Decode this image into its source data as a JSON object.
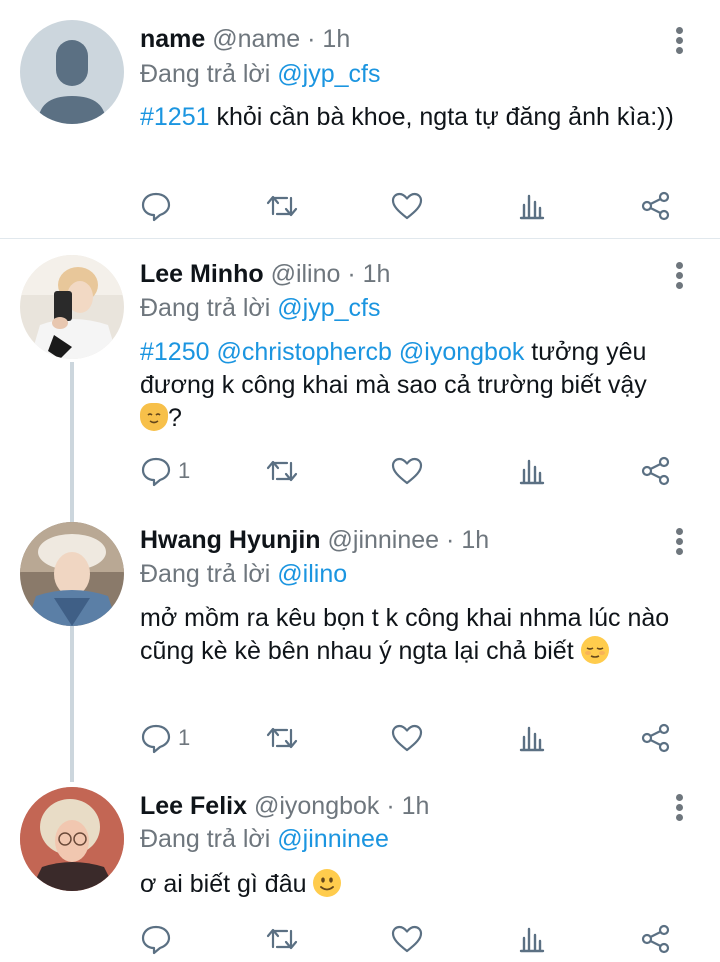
{
  "colors": {
    "link": "#1b95e0",
    "secondary": "#6e767d",
    "icon": "#5b7083",
    "divider": "#e1e8ed",
    "thread": "#ccd6dd"
  },
  "tweets": [
    {
      "name": "name",
      "handle": "@name",
      "dot": "·",
      "time": "1h",
      "reply_prefix": "Đang trả lời",
      "reply_to": "@jyp_cfs",
      "hashtag": "#1251",
      "text": " khỏi cần bà khoe, ngta tự đăng ảnh kìa:))",
      "reply_count": ""
    },
    {
      "name": "Lee Minho",
      "handle": "@ilino",
      "dot": "·",
      "time": "1h",
      "reply_prefix": "Đang trả lời",
      "reply_to": "@jyp_cfs",
      "hashtag": "#1250",
      "mention1": "@christophercb",
      "mention2": "@iyongbok",
      "text": " tưởng yêu đương k công khai mà sao cả trường biết vậy ",
      "text_end": "?",
      "emoji": "cat-face-emoji",
      "reply_count": "1"
    },
    {
      "name": "Hwang Hyunjin",
      "handle": "@jinninee",
      "dot": "·",
      "time": "1h",
      "reply_prefix": "Đang trả lời",
      "reply_to": "@ilino",
      "text": "mở mồm ra kêu bọn t k công khai nhma lúc nào cũng kè kè bên nhau ý ngta lại chả biết ",
      "emoji": "relieved-face-emoji",
      "reply_count": "1"
    },
    {
      "name": "Lee Felix",
      "handle": "@iyongbok",
      "dot": "·",
      "time": "1h",
      "reply_prefix": "Đang trả lời",
      "reply_to": "@jinninee",
      "text": "ơ ai biết gì đâu ",
      "emoji": "slightly-smiling-face-emoji",
      "reply_count": ""
    }
  ]
}
